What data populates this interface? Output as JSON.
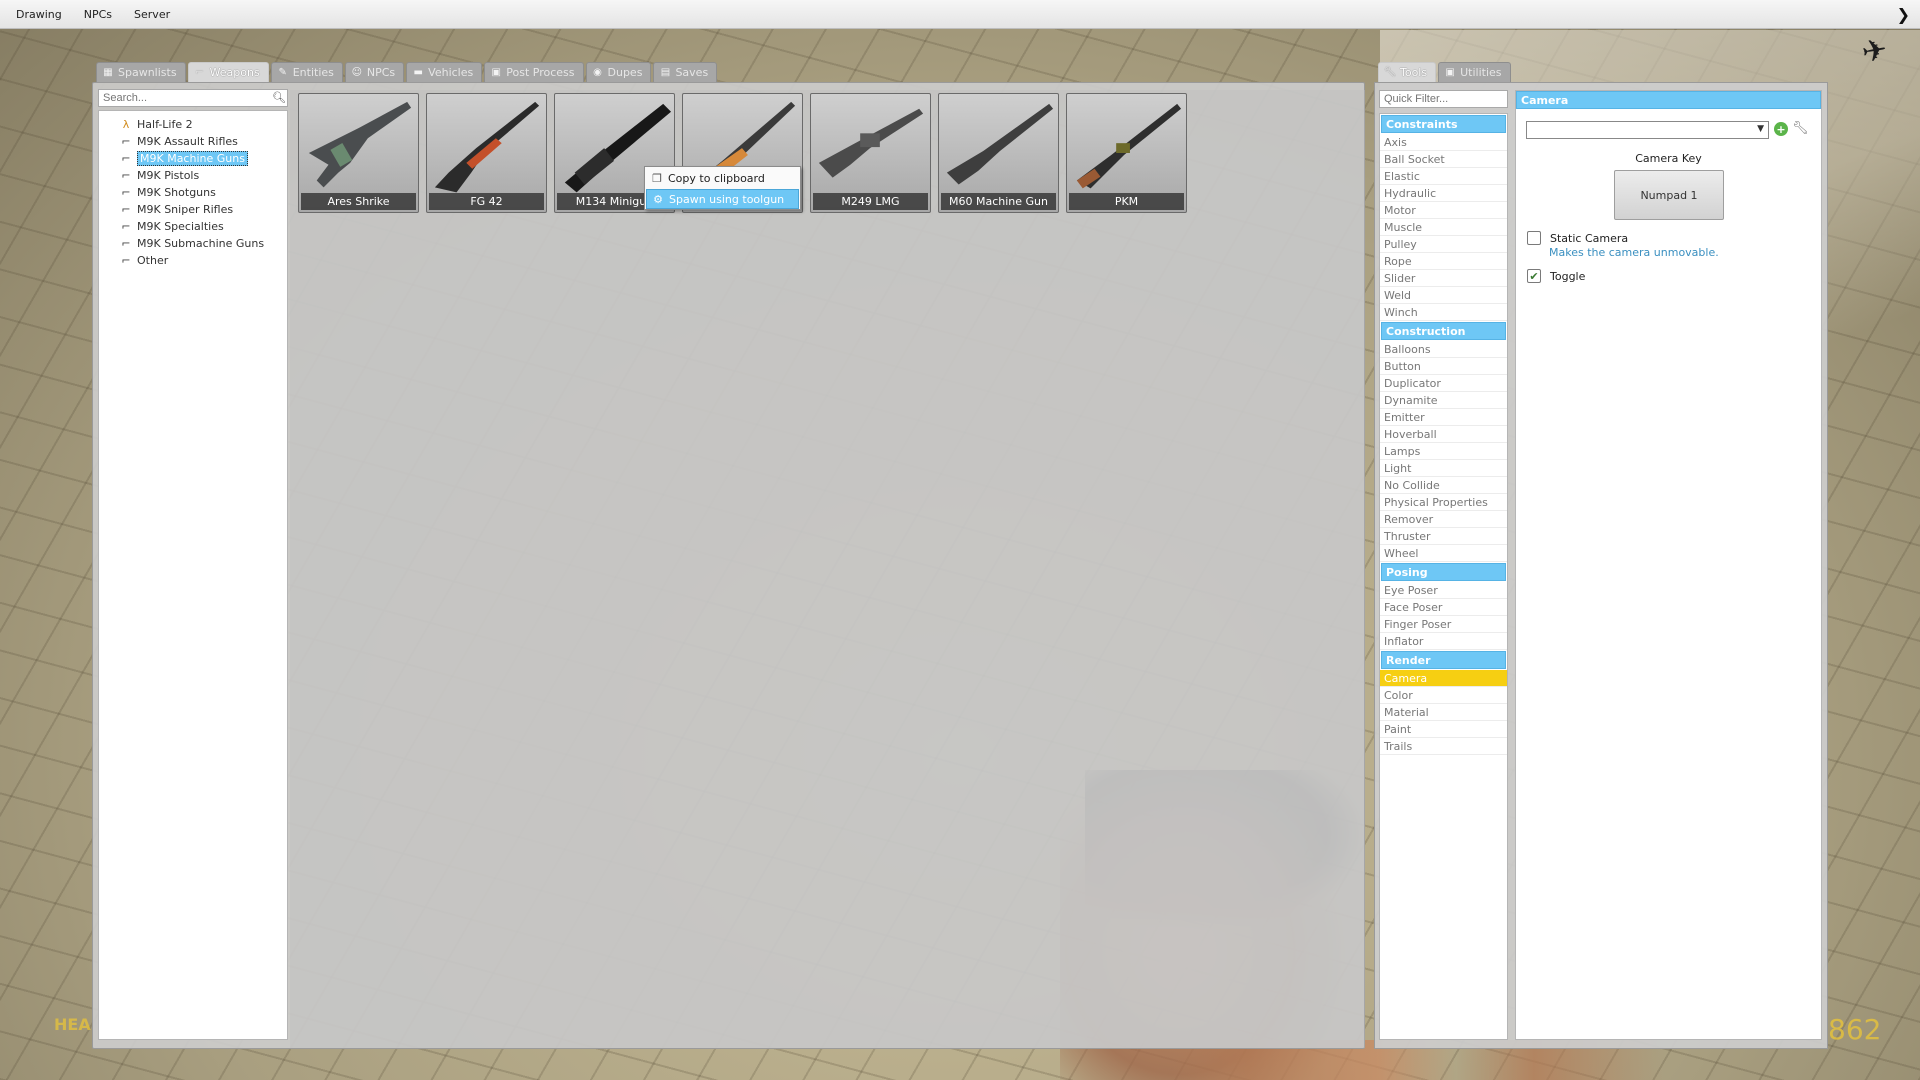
{
  "menubar": {
    "items": [
      "Drawing",
      "NPCs",
      "Server"
    ]
  },
  "spawn_tabs": [
    {
      "label": "Spawnlists",
      "icon": "grid-icon",
      "active": false
    },
    {
      "label": "Weapons",
      "icon": "gun-icon",
      "active": true
    },
    {
      "label": "Entities",
      "icon": "entity-icon",
      "active": false
    },
    {
      "label": "NPCs",
      "icon": "npc-icon",
      "active": false
    },
    {
      "label": "Vehicles",
      "icon": "car-icon",
      "active": false
    },
    {
      "label": "Post Process",
      "icon": "image-icon",
      "active": false
    },
    {
      "label": "Dupes",
      "icon": "dupe-icon",
      "active": false
    },
    {
      "label": "Saves",
      "icon": "save-icon",
      "active": false
    }
  ],
  "search": {
    "placeholder": "Search..."
  },
  "tree": [
    {
      "label": "Half-Life 2",
      "icon": "halflife-icon",
      "selected": false
    },
    {
      "label": "M9K Assault Rifles",
      "icon": "gun-icon",
      "selected": false
    },
    {
      "label": "M9K Machine Guns",
      "icon": "gun-icon",
      "selected": true
    },
    {
      "label": "M9K Pistols",
      "icon": "gun-icon",
      "selected": false
    },
    {
      "label": "M9K Shotguns",
      "icon": "gun-icon",
      "selected": false
    },
    {
      "label": "M9K Sniper Rifles",
      "icon": "gun-icon",
      "selected": false
    },
    {
      "label": "M9K Specialties",
      "icon": "gun-icon",
      "selected": false
    },
    {
      "label": "M9K Submachine Guns",
      "icon": "gun-icon",
      "selected": false
    },
    {
      "label": "Other",
      "icon": "gun-icon",
      "selected": false
    }
  ],
  "weapons": [
    {
      "name": "Ares Shrike"
    },
    {
      "name": "FG 42"
    },
    {
      "name": "M134 Minigun"
    },
    {
      "name": ""
    },
    {
      "name": "M249 LMG"
    },
    {
      "name": "M60 Machine Gun"
    },
    {
      "name": "PKM"
    }
  ],
  "context_menu": {
    "items": [
      {
        "label": "Copy to clipboard",
        "icon": "copy-icon"
      },
      {
        "label": "Spawn using toolgun",
        "icon": "toolgun-icon"
      }
    ]
  },
  "tool_tabs": [
    {
      "label": "Tools",
      "icon": "wrench-icon",
      "active": true
    },
    {
      "label": "Utilities",
      "icon": "utilities-icon",
      "active": false
    }
  ],
  "quick_filter": {
    "placeholder": "Quick Filter..."
  },
  "tool_categories": [
    {
      "name": "Constraints",
      "items": [
        "Axis",
        "Ball Socket",
        "Elastic",
        "Hydraulic",
        "Motor",
        "Muscle",
        "Pulley",
        "Rope",
        "Slider",
        "Weld",
        "Winch"
      ]
    },
    {
      "name": "Construction",
      "items": [
        "Balloons",
        "Button",
        "Duplicator",
        "Dynamite",
        "Emitter",
        "Hoverball",
        "Lamps",
        "Light",
        "No Collide",
        "Physical Properties",
        "Remover",
        "Thruster",
        "Wheel"
      ]
    },
    {
      "name": "Posing",
      "items": [
        "Eye Poser",
        "Face Poser",
        "Finger Poser",
        "Inflator"
      ]
    },
    {
      "name": "Render",
      "items": [
        "Camera",
        "Color",
        "Material",
        "Paint",
        "Trails"
      ]
    }
  ],
  "active_tool": "Camera",
  "tool_settings": {
    "title": "Camera",
    "preset_value": "",
    "camera_key_label": "Camera Key",
    "camera_key_value": "Numpad 1",
    "static_camera": {
      "label": "Static Camera",
      "help": "Makes the camera unmovable.",
      "checked": false
    },
    "toggle": {
      "label": "Toggle",
      "checked": true
    }
  },
  "hud": {
    "left_text": "HEA",
    "right_text": "862"
  },
  "colors": {
    "accent": "#6ec7f5",
    "active_tool": "#f6cf12",
    "hud": "#e8c43a"
  }
}
